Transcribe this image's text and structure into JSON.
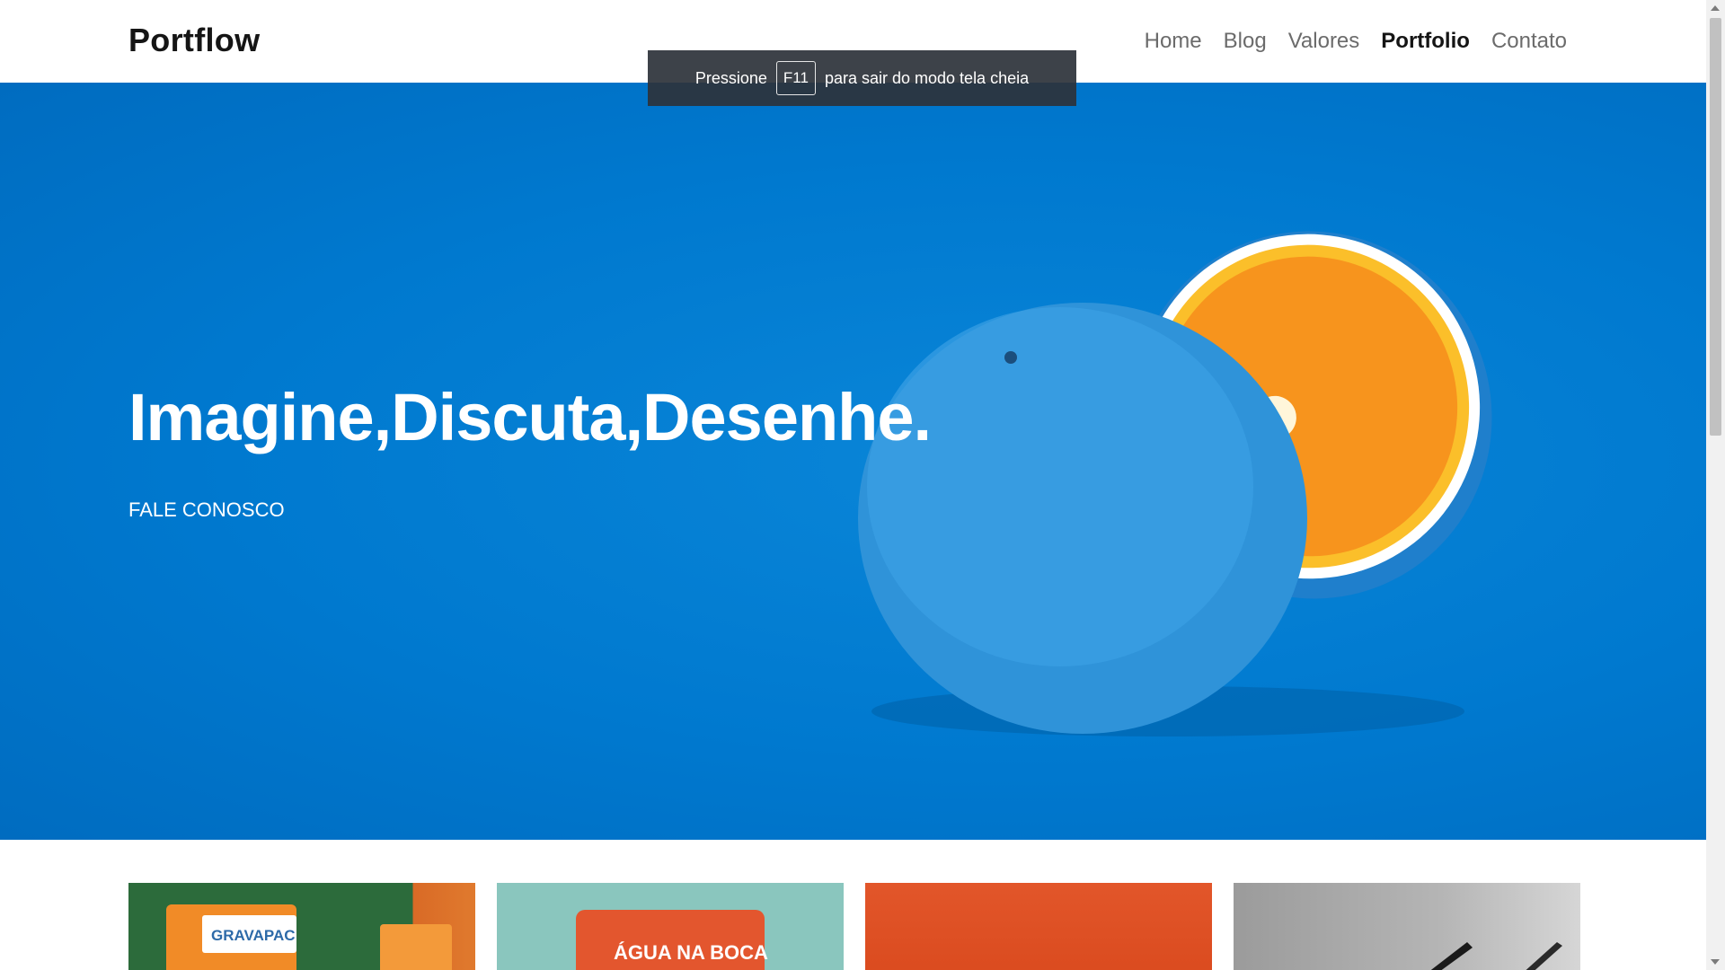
{
  "brand": {
    "name": "Portflow"
  },
  "nav": {
    "items": [
      {
        "label": "Home",
        "active": false
      },
      {
        "label": "Blog",
        "active": false
      },
      {
        "label": "Valores",
        "active": false
      },
      {
        "label": "Portfolio",
        "active": true
      },
      {
        "label": "Contato",
        "active": false
      }
    ]
  },
  "fullscreen_notice": {
    "prefix": "Pressione",
    "key": "F11",
    "suffix": "para sair do modo tela cheia"
  },
  "hero": {
    "title": "Imagine,Discuta,Desenhe.",
    "cta_label": "FALE CONOSCO"
  },
  "portfolio": {
    "cards": [
      {
        "brand_text": "GRAVAPAC"
      },
      {
        "brand_text": "ÁGUA NA BOCA"
      },
      {
        "brand_text": ""
      },
      {
        "brand_text": ""
      }
    ]
  },
  "colors": {
    "hero_blue": "#0079cf",
    "orange": "#f7941d",
    "toast_bg": "#2d323a"
  },
  "icons": {
    "scroll_up": "triangle-up-icon",
    "scroll_down": "triangle-down-icon"
  }
}
